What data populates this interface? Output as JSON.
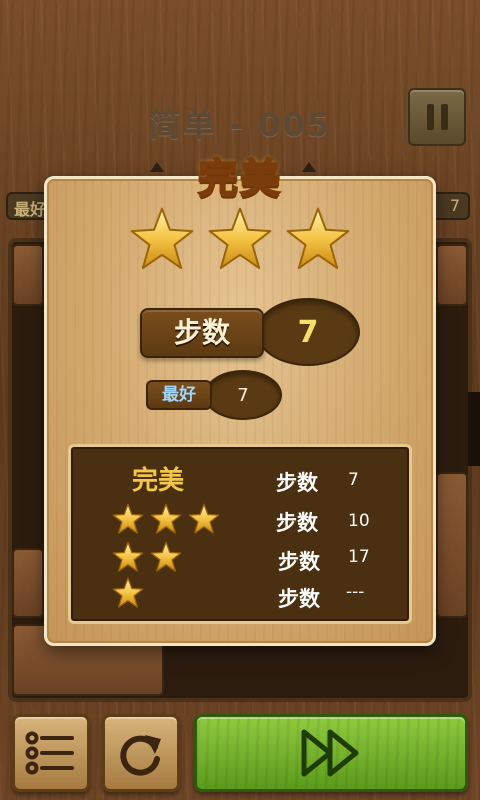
{
  "header": {
    "level_title": "简单 - 005",
    "best_label": "最好",
    "moves_value": "7"
  },
  "popup": {
    "result_title": "完美",
    "stars_earned": 3,
    "moves_label": "步数",
    "moves_value": "7",
    "best_label": "最好",
    "best_value": "7"
  },
  "ranking": {
    "title": "完美",
    "rows": [
      {
        "stars": 3,
        "label": "步数",
        "value": "7"
      },
      {
        "stars": 3,
        "label": "步数",
        "value": "10"
      },
      {
        "stars": 2,
        "label": "步数",
        "value": "17"
      },
      {
        "stars": 1,
        "label": "步数",
        "value": "---"
      }
    ]
  },
  "colors": {
    "title_orange": "#f7a51a",
    "star_gold": "#f5c445",
    "next_green": "#6fae28",
    "value_yellow": "#f3df6a"
  },
  "icons": {
    "pause": "pause-icon",
    "menu": "menu-list-icon",
    "restart": "restart-icon",
    "next": "fast-forward-icon",
    "star": "star-icon"
  }
}
